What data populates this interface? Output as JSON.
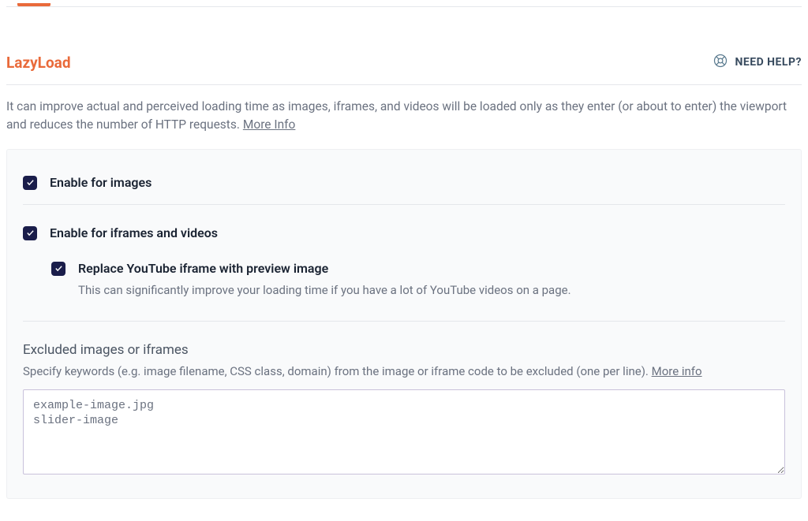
{
  "section": {
    "title": "LazyLoad",
    "help_label": "NEED HELP?",
    "description_part1": "It can improve actual and perceived loading time as images, iframes, and videos will be loaded only as they enter (or about to enter) the viewport and reduces the number of HTTP requests. ",
    "more_info_label": "More Info"
  },
  "options": {
    "enable_images": {
      "label": "Enable for images",
      "checked": true
    },
    "enable_iframes": {
      "label": "Enable for iframes and videos",
      "checked": true
    },
    "replace_youtube": {
      "label": "Replace YouTube iframe with preview image",
      "description": "This can significantly improve your loading time if you have a lot of YouTube videos on a page.",
      "checked": true
    }
  },
  "excluded": {
    "title": "Excluded images or iframes",
    "description_part1": "Specify keywords (e.g. image filename, CSS class, domain) from the image or iframe code to be excluded (one per line). ",
    "more_info_label": "More info",
    "value": "example-image.jpg\nslider-image"
  }
}
